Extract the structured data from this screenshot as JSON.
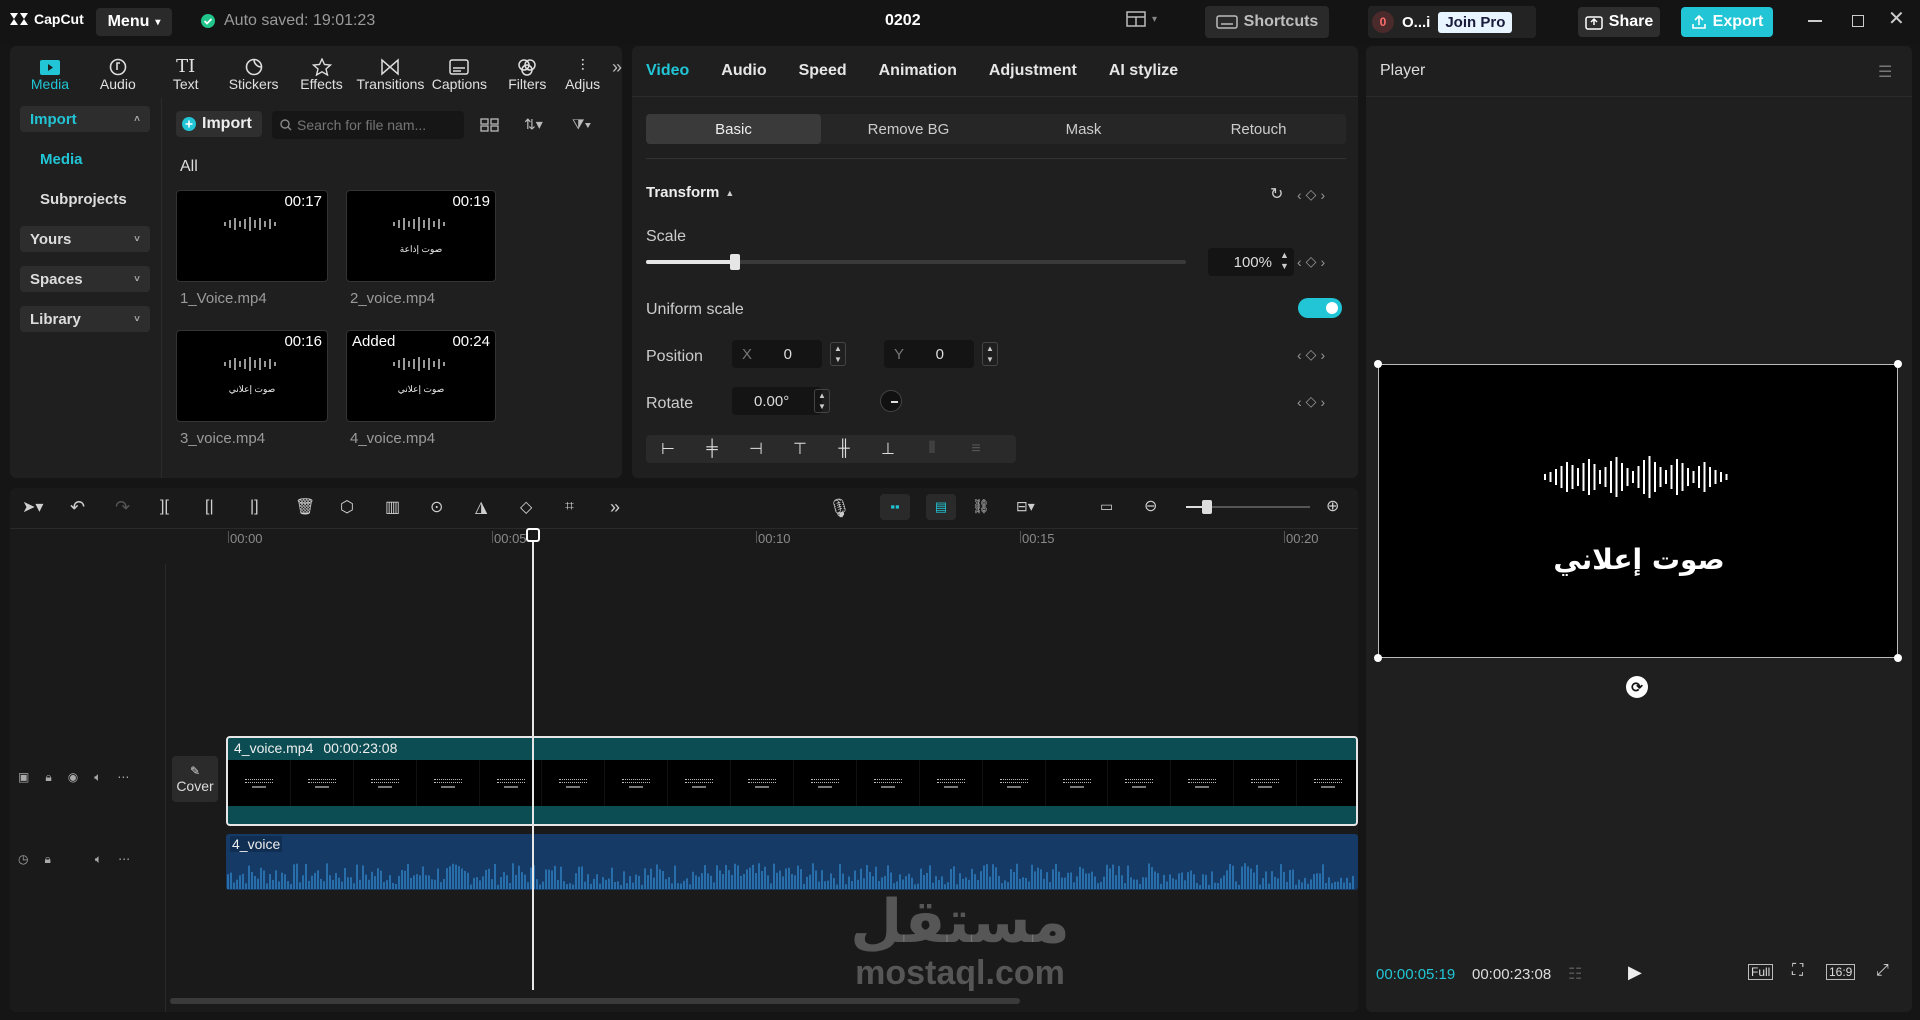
{
  "app": {
    "logo": "CapCut",
    "menu_label": "Menu",
    "autosave": "Auto saved: 19:01:23",
    "project_name": "0202"
  },
  "header": {
    "shortcuts": "Shortcuts",
    "user_badge": "0",
    "user_name": "O...i",
    "join_pro": "Join Pro",
    "share": "Share",
    "export": "Export"
  },
  "colors": {
    "accent": "#21c5d6",
    "video_track": "#0b4d52",
    "audio_track": "#153a66",
    "waveform": "#2f7fc2"
  },
  "toolbar": {
    "tabs": [
      {
        "label": "Media",
        "icon": "media-icon",
        "active": true
      },
      {
        "label": "Audio",
        "icon": "audio-icon"
      },
      {
        "label": "Text",
        "icon": "text-icon"
      },
      {
        "label": "Stickers",
        "icon": "stickers-icon"
      },
      {
        "label": "Effects",
        "icon": "effects-icon"
      },
      {
        "label": "Transitions",
        "icon": "transitions-icon"
      },
      {
        "label": "Captions",
        "icon": "captions-icon"
      },
      {
        "label": "Filters",
        "icon": "filters-icon"
      },
      {
        "label": "Adjus",
        "icon": "adjust-icon"
      }
    ]
  },
  "media_nav": {
    "import": "Import",
    "media": "Media",
    "subprojects": "Subprojects",
    "yours": "Yours",
    "spaces": "Spaces",
    "library": "Library"
  },
  "media_panel": {
    "import_btn": "Import",
    "search_placeholder": "Search for file nam...",
    "section": "All",
    "items": [
      {
        "name": "1_Voice.mp4",
        "duration": "00:17",
        "caption": "",
        "added": ""
      },
      {
        "name": "2_voice.mp4",
        "duration": "00:19",
        "caption": "صوت إذاعة",
        "added": ""
      },
      {
        "name": "3_voice.mp4",
        "duration": "00:16",
        "caption": "صوت إعلاني",
        "added": ""
      },
      {
        "name": "4_voice.mp4",
        "duration": "00:24",
        "caption": "صوت إعلاني",
        "added": "Added"
      }
    ]
  },
  "properties": {
    "tabs": [
      "Video",
      "Audio",
      "Speed",
      "Animation",
      "Adjustment",
      "AI stylize"
    ],
    "active_tab": "Video",
    "subtabs": [
      "Basic",
      "Remove BG",
      "Mask",
      "Retouch"
    ],
    "active_subtab": "Basic",
    "transform": "Transform",
    "scale_label": "Scale",
    "scale_value": "100%",
    "scale_percent": 100,
    "uniform": "Uniform scale",
    "uniform_on": true,
    "position_label": "Position",
    "x_label": "X",
    "x_value": "0",
    "y_label": "Y",
    "y_value": "0",
    "rotate_label": "Rotate",
    "rotate_value": "0.00°"
  },
  "player": {
    "title": "Player",
    "caption": "صوت إعلاني",
    "current_time": "00:00:05:19",
    "total_time": "00:00:23:08",
    "full": "Full",
    "ratio": "16:9"
  },
  "timeline": {
    "ruler": [
      "00:00",
      "00:05",
      "00:10",
      "00:15",
      "00:20"
    ],
    "video_clip": {
      "name": "4_voice.mp4",
      "duration": "00:00:23:08"
    },
    "audio_clip": {
      "name": "4_voice"
    },
    "cover": "Cover"
  },
  "watermark": {
    "arabic": "مستقل",
    "latin": "mostaql.com"
  }
}
